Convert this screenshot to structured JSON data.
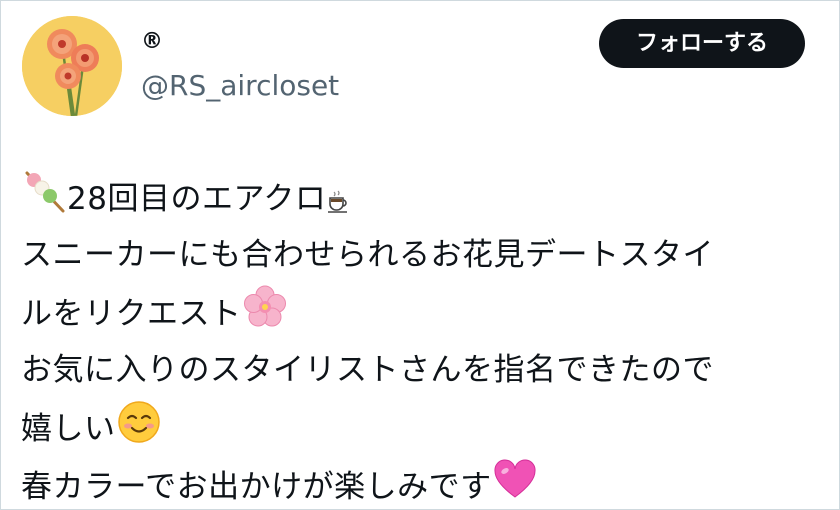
{
  "author": {
    "display_name": "®",
    "handle": "@RS_aircloset",
    "avatar_icon": "gerbera-flowers-avatar"
  },
  "follow_button": {
    "label": "フォローする"
  },
  "tweet": {
    "lines": [
      {
        "icon": "dango-icon",
        "text": "28回目のエアクロ",
        "trailing_icon": "coffee-icon"
      },
      {
        "text": "スニーカーにも合わせられるお花見デートスタイ"
      },
      {
        "text": "ルをリクエスト",
        "trailing_icon": "cherry-blossom-icon"
      },
      {
        "text": "お気に入りのスタイリストさんを指名できたので"
      },
      {
        "text": "嬉しい",
        "trailing_icon": "smiling-face-icon"
      },
      {
        "text": "春カラーでお出かけが楽しみです",
        "trailing_icon": "pink-heart-icon"
      }
    ]
  },
  "colors": {
    "text_primary": "#0f1419",
    "text_secondary": "#536471",
    "button_bg": "#0f1419",
    "button_text": "#ffffff",
    "border": "#cfd9de",
    "avatar_bg": "#f6cf62"
  }
}
